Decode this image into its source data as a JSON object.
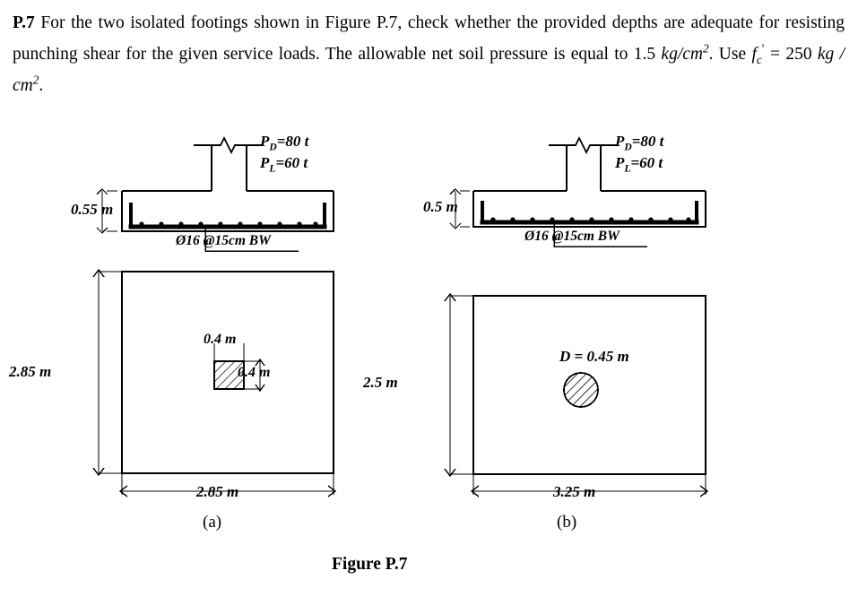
{
  "statement": {
    "label": "P.7",
    "text_part1": "For the two isolated footings shown in Figure P.7, check whether the provided depths are adequate for resisting punching shear for the given service loads. The allowable net soil pressure is equal to 1.5 ",
    "pressure_units": "kg/cm",
    "pressure_exp": "2",
    "use_word": ". Use",
    "fc_symbol": "f",
    "fc_sub": "c",
    "fc_prime": "′",
    "fc_value": "= 250 ",
    "fc_units": "kg / cm",
    "fc_exp": "2",
    "period": "."
  },
  "figure": {
    "caption": "Figure P.7",
    "sub_caption_a": "(a)",
    "sub_caption_b": "(b)"
  },
  "footing_a": {
    "section": {
      "depth_label": "0.55 m",
      "load_dead": "P",
      "load_dead_sub": "D",
      "load_dead_value": "=80 t",
      "load_live": "P",
      "load_live_sub": "L",
      "load_live_value": "=60 t",
      "rebar_label": "Ø16 @15cm BW"
    },
    "plan": {
      "height_label": "2.85 m",
      "width_label": "2.85 m",
      "column_width_label": "0.4 m",
      "column_height_label": "0.4 m"
    }
  },
  "footing_b": {
    "section": {
      "depth_label": "0.5 m",
      "load_dead": "P",
      "load_dead_sub": "D",
      "load_dead_value": "=80 t",
      "load_live": "P",
      "load_live_sub": "L",
      "load_live_value": "=60 t",
      "rebar_label": "Ø16 @15cm BW"
    },
    "plan": {
      "height_label": "2.5 m",
      "width_label": "3.25 m",
      "column_diameter_label": "D = 0.45 m"
    }
  },
  "colors": {
    "ink": "#000000",
    "paper": "#ffffff"
  }
}
